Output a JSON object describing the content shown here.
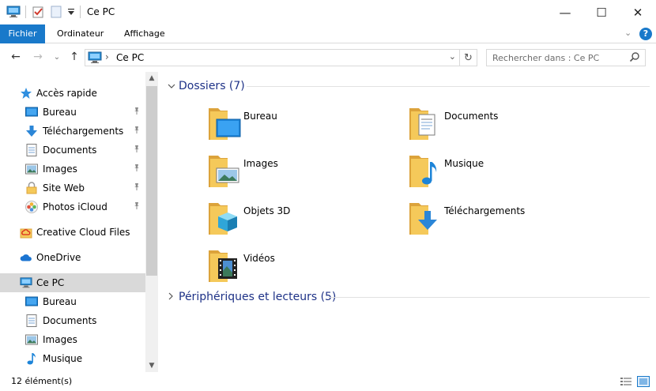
{
  "window": {
    "title": "Ce PC",
    "minimize_glyph": "—",
    "maximize_glyph": "☐",
    "close_glyph": "✕"
  },
  "ribbon": {
    "tabs": [
      {
        "label": "Fichier",
        "active": true
      },
      {
        "label": "Ordinateur"
      },
      {
        "label": "Affichage"
      }
    ],
    "expand_glyph": "⌄",
    "help_glyph": "?"
  },
  "address": {
    "back_glyph": "←",
    "forward_glyph": "→",
    "recent_glyph": "⌄",
    "up_glyph": "↑",
    "separator_glyph": "›",
    "path": "Ce PC",
    "dropdown_glyph": "⌄",
    "refresh_glyph": "↻"
  },
  "search": {
    "placeholder": "Rechercher dans : Ce PC"
  },
  "sidebar": {
    "items": [
      {
        "label": "Accès rapide",
        "icon": "star-icon",
        "level": 0
      },
      {
        "label": "Bureau",
        "icon": "desktop-icon",
        "level": 1,
        "pinned": true
      },
      {
        "label": "Téléchargements",
        "icon": "download-icon",
        "level": 1,
        "pinned": true
      },
      {
        "label": "Documents",
        "icon": "document-icon",
        "level": 1,
        "pinned": true
      },
      {
        "label": "Images",
        "icon": "picture-icon",
        "level": 1,
        "pinned": true
      },
      {
        "label": "Site Web",
        "icon": "lock-folder-icon",
        "level": 1,
        "pinned": true
      },
      {
        "label": "Photos iCloud",
        "icon": "photos-icon",
        "level": 1,
        "pinned": true
      },
      {
        "label": "Creative Cloud Files",
        "icon": "creative-cloud-icon",
        "level": 0
      },
      {
        "label": "OneDrive",
        "icon": "cloud-icon",
        "level": 0
      },
      {
        "label": "Ce PC",
        "icon": "computer-icon",
        "level": 0,
        "selected": true
      },
      {
        "label": "Bureau",
        "icon": "desktop-icon",
        "level": 1
      },
      {
        "label": "Documents",
        "icon": "document-icon",
        "level": 1
      },
      {
        "label": "Images",
        "icon": "picture-icon",
        "level": 1
      },
      {
        "label": "Musique",
        "icon": "music-icon",
        "level": 1
      }
    ],
    "pin_glyph": "📌"
  },
  "groups": {
    "folders": {
      "title": "Dossiers (7)",
      "expanded": true,
      "items": [
        {
          "label": "Bureau",
          "icon": "desktop-folder-icon"
        },
        {
          "label": "Documents",
          "icon": "documents-folder-icon"
        },
        {
          "label": "Images",
          "icon": "images-folder-icon"
        },
        {
          "label": "Musique",
          "icon": "music-folder-icon"
        },
        {
          "label": "Objets 3D",
          "icon": "objects-3d-folder-icon"
        },
        {
          "label": "Téléchargements",
          "icon": "downloads-folder-icon"
        },
        {
          "label": "Vidéos",
          "icon": "videos-folder-icon"
        }
      ]
    },
    "devices": {
      "title": "Périphériques et lecteurs (5)",
      "expanded": false
    }
  },
  "status": {
    "count": "12 élément(s)"
  },
  "colors": {
    "accent": "#1979ca",
    "group_title": "#1e3287",
    "folder": "#f5c95a",
    "folder_dark": "#dca33b",
    "selection": "#d9d9d9"
  }
}
